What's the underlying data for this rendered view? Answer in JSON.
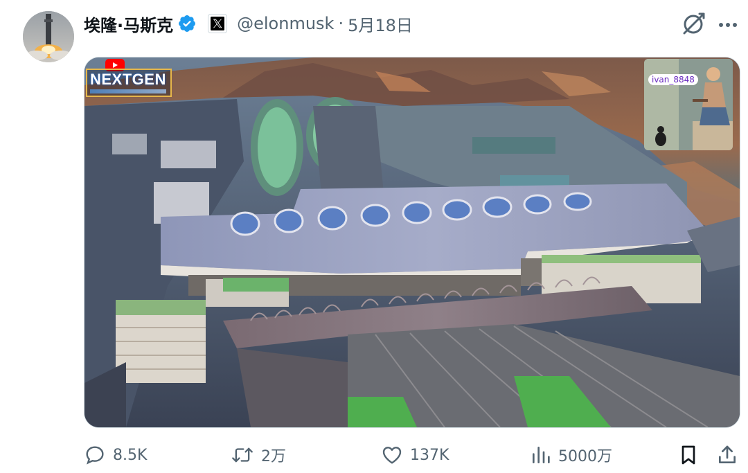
{
  "author": {
    "display_name": "埃隆·马斯克",
    "verified": true,
    "affiliation_icon": "x-logo-icon",
    "handle": "@elonmusk",
    "separator": "·",
    "date": "5月18日"
  },
  "header_icons": [
    "grok-icon",
    "more-icon"
  ],
  "media": {
    "type": "video",
    "channel_logo": "NEXTGEN",
    "pip_label": "ivan_8848"
  },
  "actions": {
    "reply": {
      "icon": "reply-icon",
      "count": "8.5K"
    },
    "retweet": {
      "icon": "retweet-icon",
      "count": "2万"
    },
    "like": {
      "icon": "heart-icon",
      "count": "137K"
    },
    "views": {
      "icon": "views-icon",
      "count": "5000万"
    },
    "bookmark": {
      "icon": "bookmark-icon"
    },
    "share": {
      "icon": "share-icon"
    }
  },
  "colors": {
    "verified": "#1d9bf0",
    "secondary_text": "#536471",
    "primary_text": "#0f1419"
  }
}
